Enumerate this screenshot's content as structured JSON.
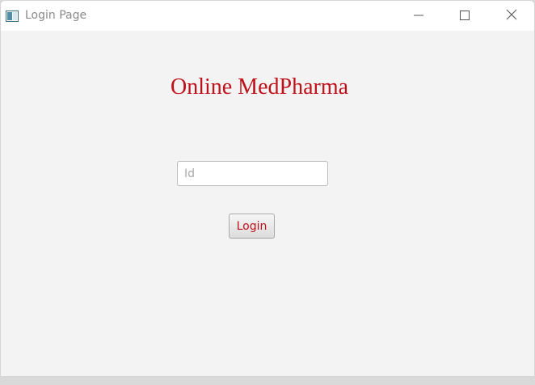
{
  "window": {
    "title": "Login Page",
    "controls": {
      "minimize": "minimize-icon",
      "maximize": "maximize-icon",
      "close": "close-icon"
    }
  },
  "main": {
    "heading": "Online MedPharma",
    "id_field": {
      "placeholder": "Id",
      "value": ""
    },
    "login_label": "Login"
  },
  "colors": {
    "accent": "#c0111a",
    "background": "#f3f3f3",
    "titlebar": "#ffffff"
  }
}
